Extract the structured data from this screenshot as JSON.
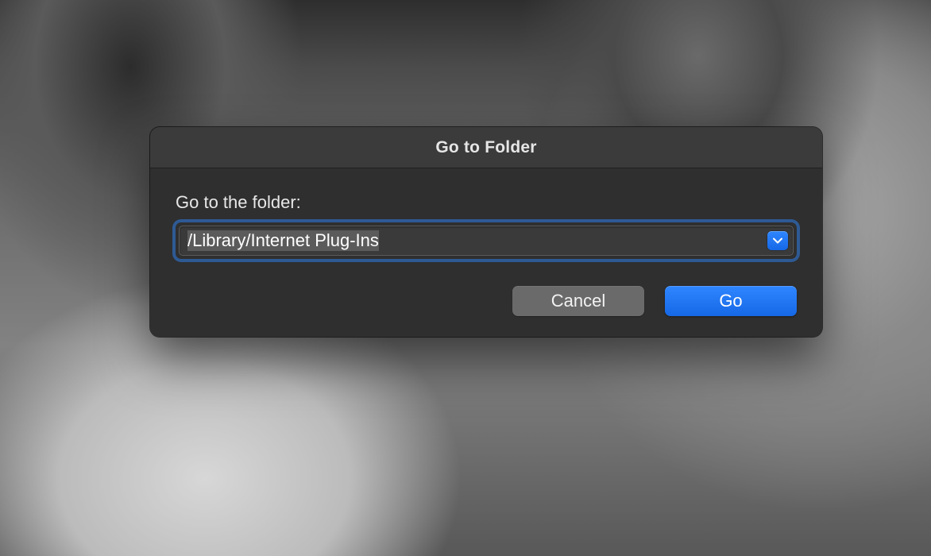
{
  "dialog": {
    "title": "Go to Folder",
    "field_label": "Go to the folder:",
    "path_value": "/Library/Internet Plug-Ins",
    "buttons": {
      "cancel": "Cancel",
      "go": "Go"
    }
  }
}
